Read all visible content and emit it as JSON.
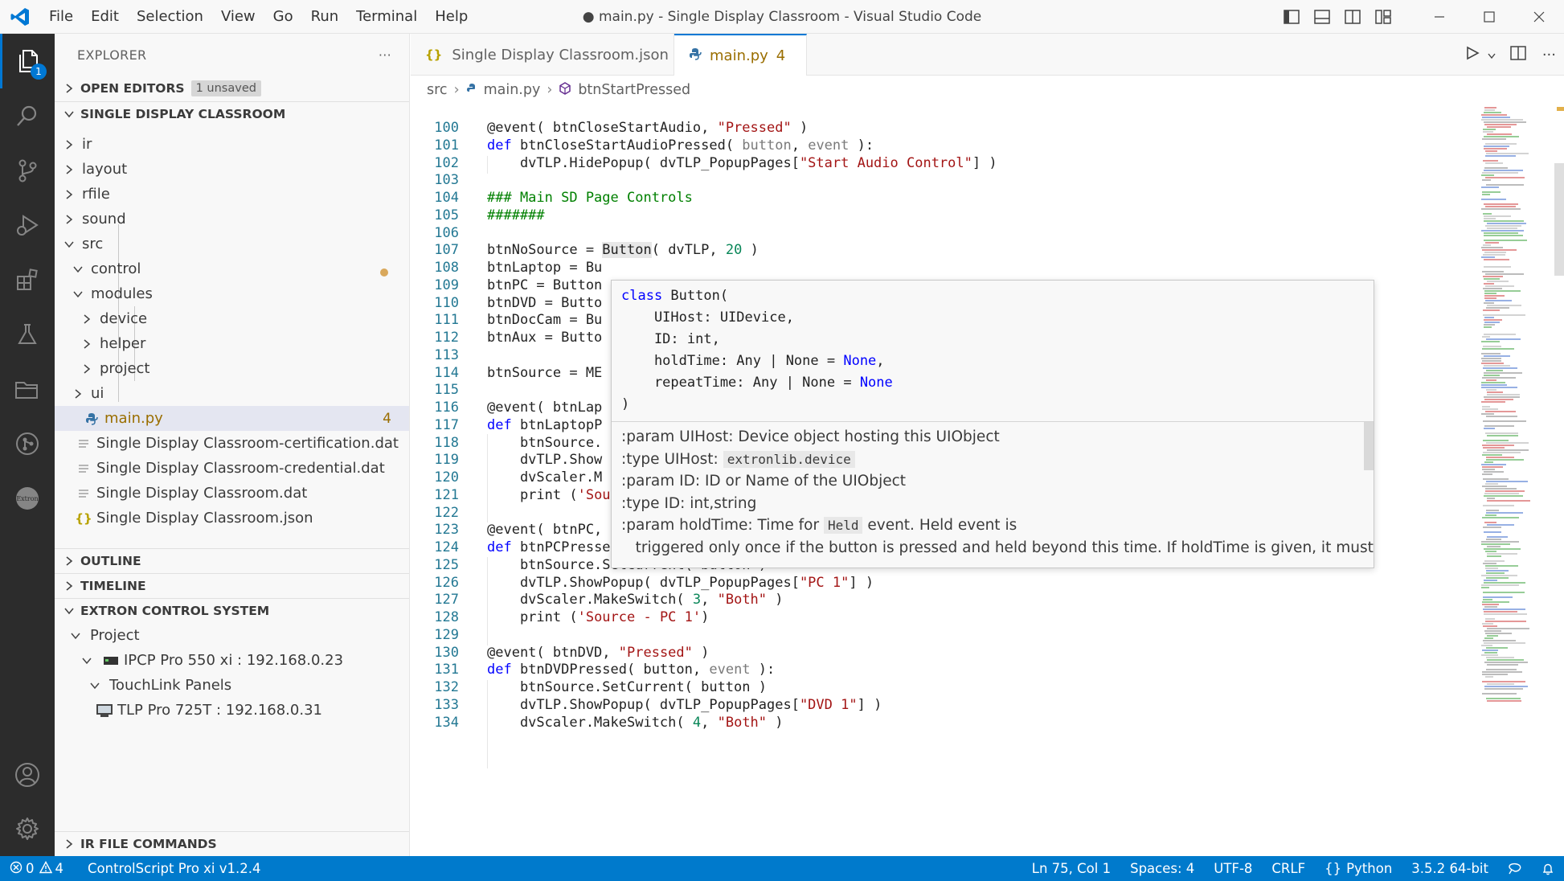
{
  "window": {
    "title": "● main.py - Single Display Classroom - Visual Studio Code"
  },
  "menu": [
    "File",
    "Edit",
    "Selection",
    "View",
    "Go",
    "Run",
    "Terminal",
    "Help"
  ],
  "activity": {
    "explorer_badge": "1"
  },
  "sidebar": {
    "header": "EXPLORER",
    "more": "···",
    "open_editors": {
      "label": "OPEN EDITORS",
      "badge": "1 unsaved"
    },
    "workspace": "SINGLE DISPLAY CLASSROOM",
    "tree": [
      {
        "label": "ir"
      },
      {
        "label": "layout"
      },
      {
        "label": "rfile"
      },
      {
        "label": "sound"
      },
      {
        "label": "src"
      },
      {
        "label": "control"
      },
      {
        "label": "modules"
      },
      {
        "label": "device"
      },
      {
        "label": "helper"
      },
      {
        "label": "project"
      },
      {
        "label": "ui"
      },
      {
        "label": "main.py",
        "problems": "4"
      },
      {
        "label": "Single Display Classroom-certification.dat"
      },
      {
        "label": "Single Display Classroom-credential.dat"
      },
      {
        "label": "Single Display Classroom.dat"
      },
      {
        "label": "Single Display Classroom.json"
      }
    ],
    "outline": "OUTLINE",
    "timeline": "TIMELINE",
    "extron": {
      "label": "EXTRON CONTROL SYSTEM",
      "project": "Project",
      "controller": "IPCP Pro 550 xi : 192.168.0.23",
      "touchlink": "TouchLink Panels",
      "panel": "TLP Pro 725T : 192.168.0.31"
    },
    "ir_commands": "IR FILE COMMANDS"
  },
  "tabs": [
    {
      "label": "Single Display Classroom.json"
    },
    {
      "label": "main.py",
      "problems": "4"
    }
  ],
  "breadcrumb": [
    "src",
    "main.py",
    "btnStartPressed"
  ],
  "code": {
    "line_numbers": [
      "100",
      "101",
      "102",
      "103",
      "104",
      "105",
      "106",
      "107",
      "108",
      "109",
      "110",
      "111",
      "112",
      "113",
      "114",
      "115",
      "116",
      "117",
      "118",
      "119",
      "120",
      "121",
      "122",
      "123",
      "124",
      "125",
      "126",
      "127",
      "128",
      "129",
      "130",
      "131",
      "132",
      "133",
      "134"
    ]
  },
  "hover": {
    "signature": [
      "class Button(",
      "    UIHost: UIDevice,",
      "    ID: int,",
      "    holdTime: Any | None = None,",
      "    repeatTime: Any | None = None",
      ")"
    ],
    "doc": {
      "p1": ":param UIHost: Device object hosting this UIObject",
      "p2_prefix": ":type UIHost: ",
      "p2_code": "extronlib.device",
      "p3": ":param ID: ID or Name of the UIObject",
      "p4": ":type ID: int,string",
      "p5_prefix": ":param holdTime: Time for ",
      "p5_code": "Held",
      "p5_suffix": " event. Held event is",
      "p6": "   triggered only once if the button is pressed and held beyond this time. If holdTime is given, it must be"
    }
  },
  "status": {
    "errors": "0",
    "warnings": "4",
    "extension": "ControlScript Pro xi v1.2.4",
    "position": "Ln 75, Col 1",
    "spaces": "Spaces: 4",
    "encoding": "UTF-8",
    "eol": "CRLF",
    "language": "Python",
    "interpreter": "3.5.2 64-bit"
  },
  "colors": {
    "accent": "#0078d4",
    "statusbar": "#007acc",
    "activitybar": "#2c2c2c",
    "keyword": "#0000ff",
    "string": "#a31515",
    "comment": "#008000",
    "number": "#098658"
  }
}
